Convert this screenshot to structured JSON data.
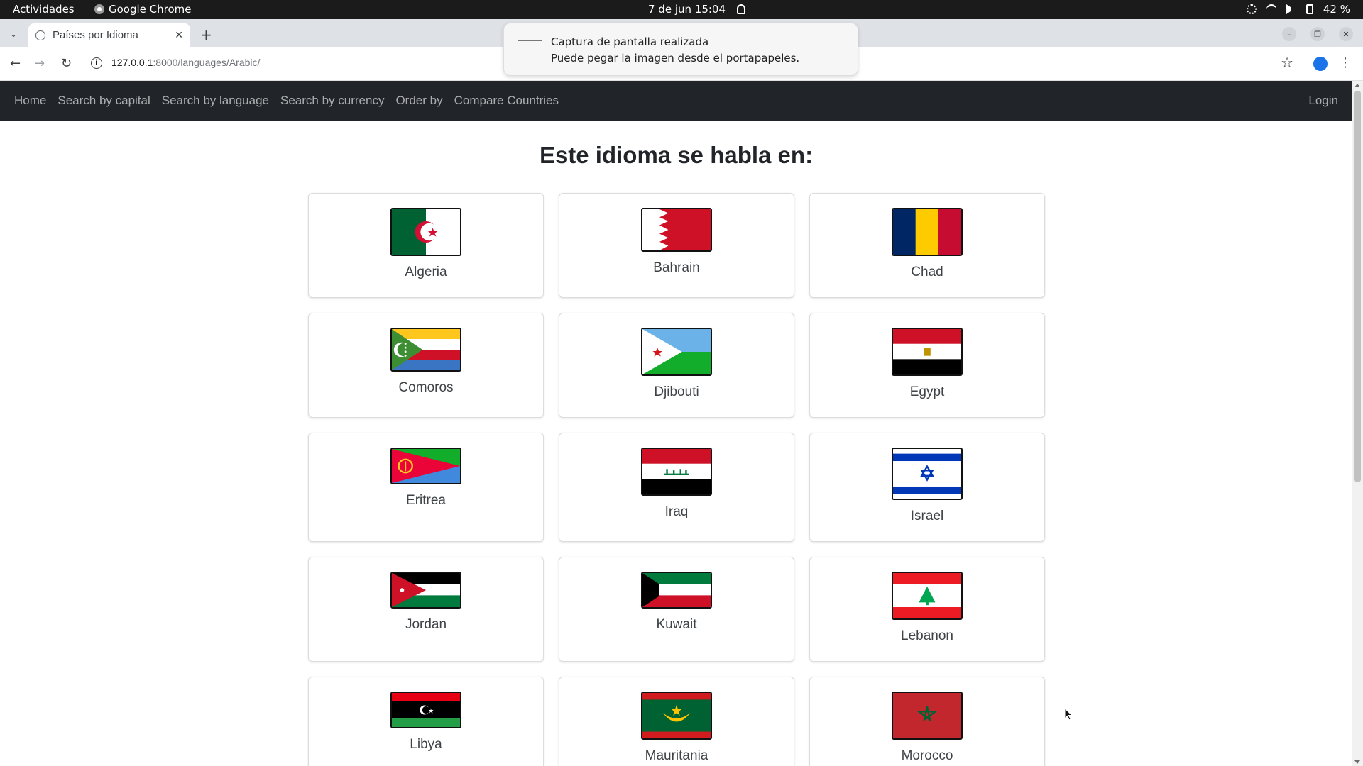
{
  "system_bar": {
    "activities": "Actividades",
    "app_name": "Google Chrome",
    "datetime": "7 de jun  15:04",
    "battery": "42 %"
  },
  "browser": {
    "tab_title": "Países por Idioma",
    "url_host": "127.0.0.1",
    "url_path": ":8000/languages/Arabic/"
  },
  "notification": {
    "title": "Captura de pantalla realizada",
    "body": "Puede pegar la imagen desde el portapapeles."
  },
  "navbar": {
    "items": [
      "Home",
      "Search by capital",
      "Search by language",
      "Search by currency",
      "Order by",
      "Compare Countries"
    ],
    "login": "Login"
  },
  "page": {
    "heading": "Este idioma se habla en:"
  },
  "countries": [
    {
      "name": "Algeria",
      "flag": "algeria-flag"
    },
    {
      "name": "Bahrain",
      "flag": "bahrain-flag"
    },
    {
      "name": "Chad",
      "flag": "chad-flag"
    },
    {
      "name": "Comoros",
      "flag": "comoros-flag"
    },
    {
      "name": "Djibouti",
      "flag": "djibouti-flag"
    },
    {
      "name": "Egypt",
      "flag": "egypt-flag"
    },
    {
      "name": "Eritrea",
      "flag": "eritrea-flag"
    },
    {
      "name": "Iraq",
      "flag": "iraq-flag"
    },
    {
      "name": "Israel",
      "flag": "israel-flag"
    },
    {
      "name": "Jordan",
      "flag": "jordan-flag"
    },
    {
      "name": "Kuwait",
      "flag": "kuwait-flag"
    },
    {
      "name": "Lebanon",
      "flag": "lebanon-flag"
    },
    {
      "name": "Libya",
      "flag": "libya-flag"
    },
    {
      "name": "Mauritania",
      "flag": "mauritania-flag"
    },
    {
      "name": "Morocco",
      "flag": "morocco-flag"
    }
  ]
}
